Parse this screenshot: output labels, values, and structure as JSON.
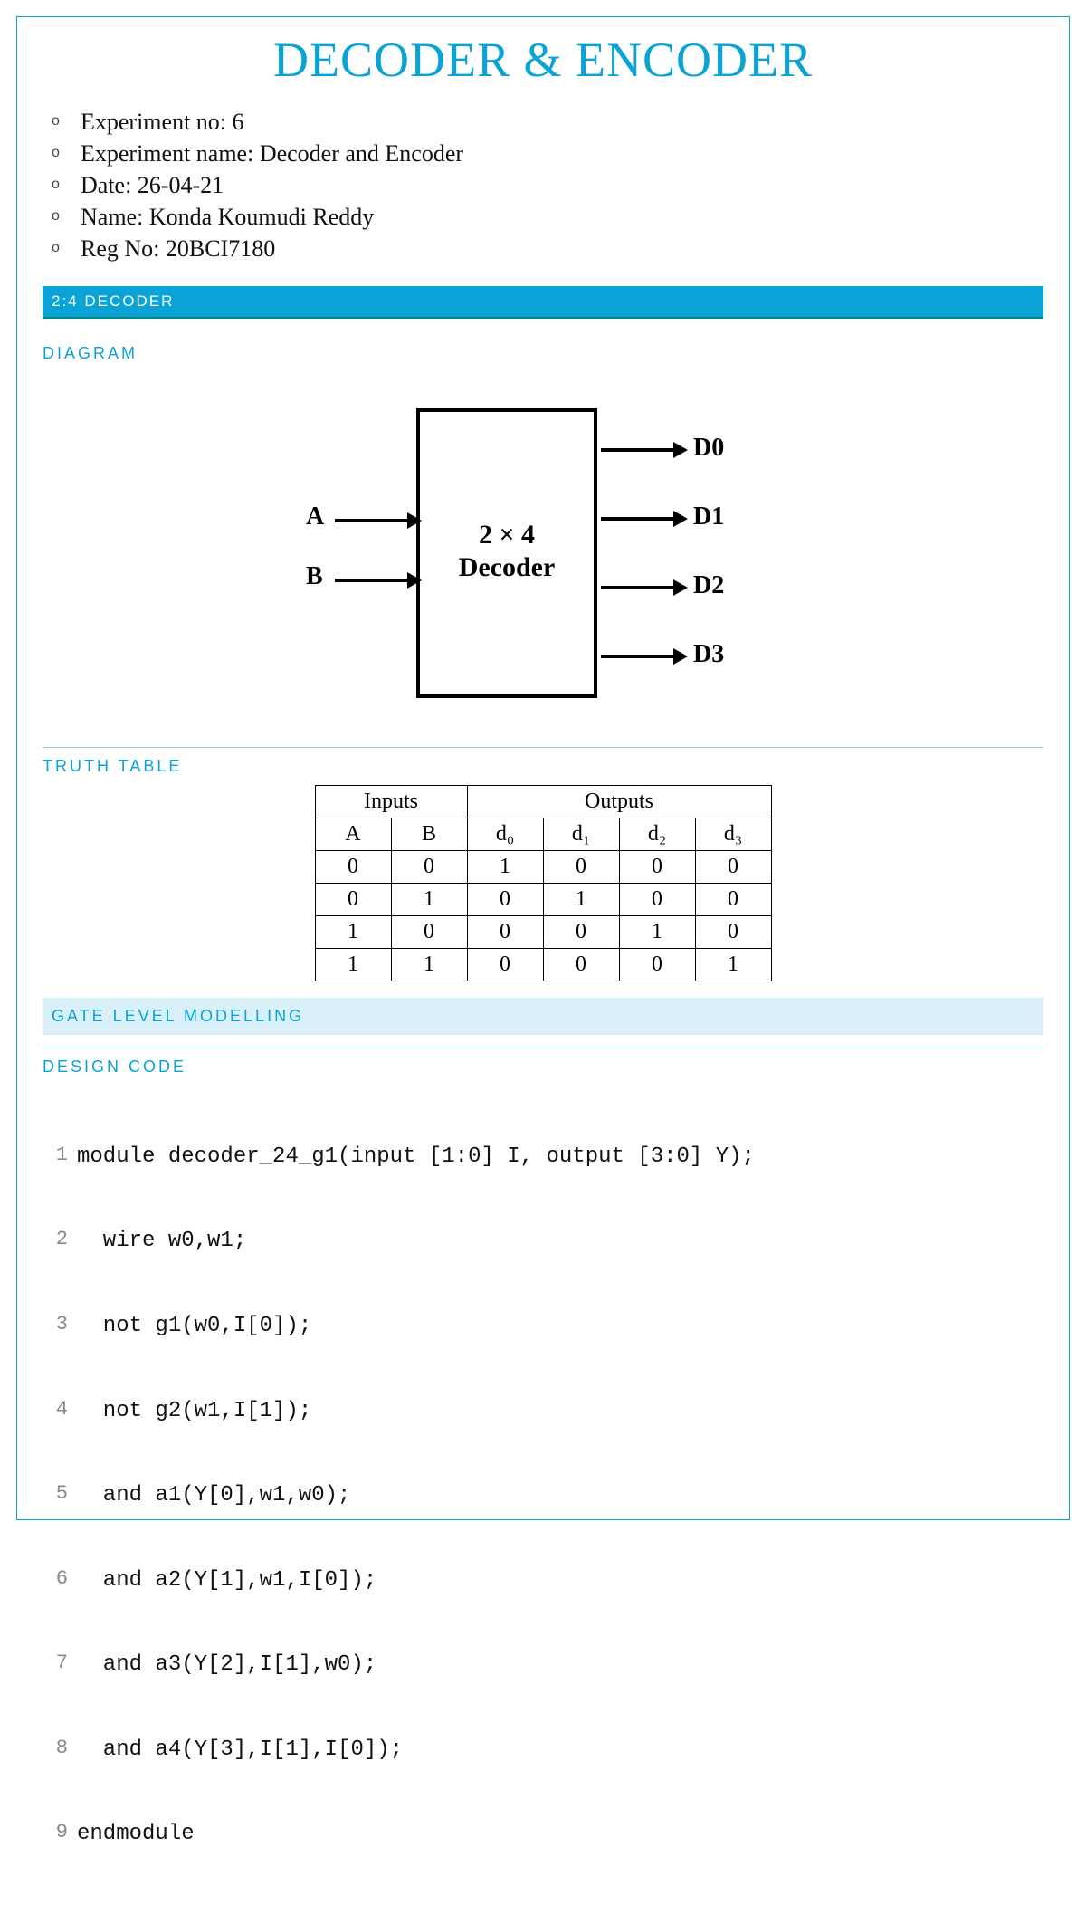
{
  "title": "DECODER & ENCODER",
  "meta": [
    "Experiment no: 6",
    "Experiment name: Decoder and Encoder",
    "Date: 26-04-21",
    "Name: Konda Koumudi Reddy",
    "Reg No: 20BCI7180"
  ],
  "sections": {
    "decoder_header": "2:4 DECODER",
    "diagram_header": "DIAGRAM",
    "truth_table_header": "TRUTH TABLE",
    "gate_level_header": "GATE LEVEL MODELLING",
    "design_code_header": "DESIGN CODE"
  },
  "diagram": {
    "box_label_line1": "2  × 4",
    "box_label_line2": "Decoder",
    "inputs": [
      "A",
      "B"
    ],
    "outputs": [
      "D0",
      "D1",
      "D2",
      "D3"
    ]
  },
  "truth_table": {
    "group_inputs": "Inputs",
    "group_outputs": "Outputs",
    "headers": [
      "A",
      "B",
      "d₀",
      "d₁",
      "d₂",
      "d₃"
    ],
    "rows": [
      [
        "0",
        "0",
        "1",
        "0",
        "0",
        "0"
      ],
      [
        "0",
        "1",
        "0",
        "1",
        "0",
        "0"
      ],
      [
        "1",
        "0",
        "0",
        "0",
        "1",
        "0"
      ],
      [
        "1",
        "1",
        "0",
        "0",
        "0",
        "1"
      ]
    ]
  },
  "code": {
    "lines": [
      "module decoder_24_g1(input [1:0] I, output [3:0] Y);",
      "  wire w0,w1;",
      "  not g1(w0,I[0]);",
      "  not g2(w1,I[1]);",
      "  and a1(Y[0],w1,w0);",
      "  and a2(Y[1],w1,I[0]);",
      "  and a3(Y[2],I[1],w0);",
      "  and a4(Y[3],I[1],I[0]);",
      "endmodule"
    ]
  }
}
